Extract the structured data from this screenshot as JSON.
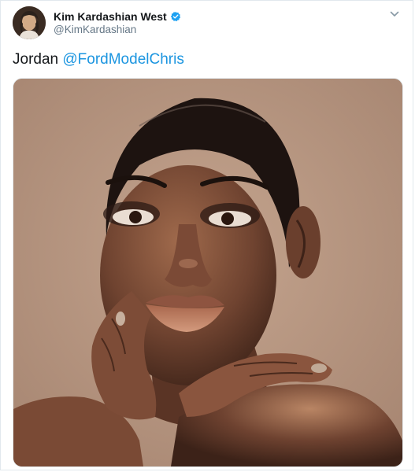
{
  "tweet": {
    "author": {
      "display_name": "Kim Kardashian West",
      "handle": "@KimKardashian",
      "verified": true,
      "avatar_icon": "profile-photo"
    },
    "text_prefix": "Jordan ",
    "mention": "@FordModelChris",
    "menu_icon": "chevron-down-icon",
    "media": {
      "type": "photo",
      "subject": "beauty portrait"
    }
  },
  "colors": {
    "name": "#14171a",
    "handle": "#657786",
    "link": "#1b95e0",
    "verified": "#1da1f2",
    "photo_background": "#b89782",
    "border": "#e1e8ed"
  }
}
